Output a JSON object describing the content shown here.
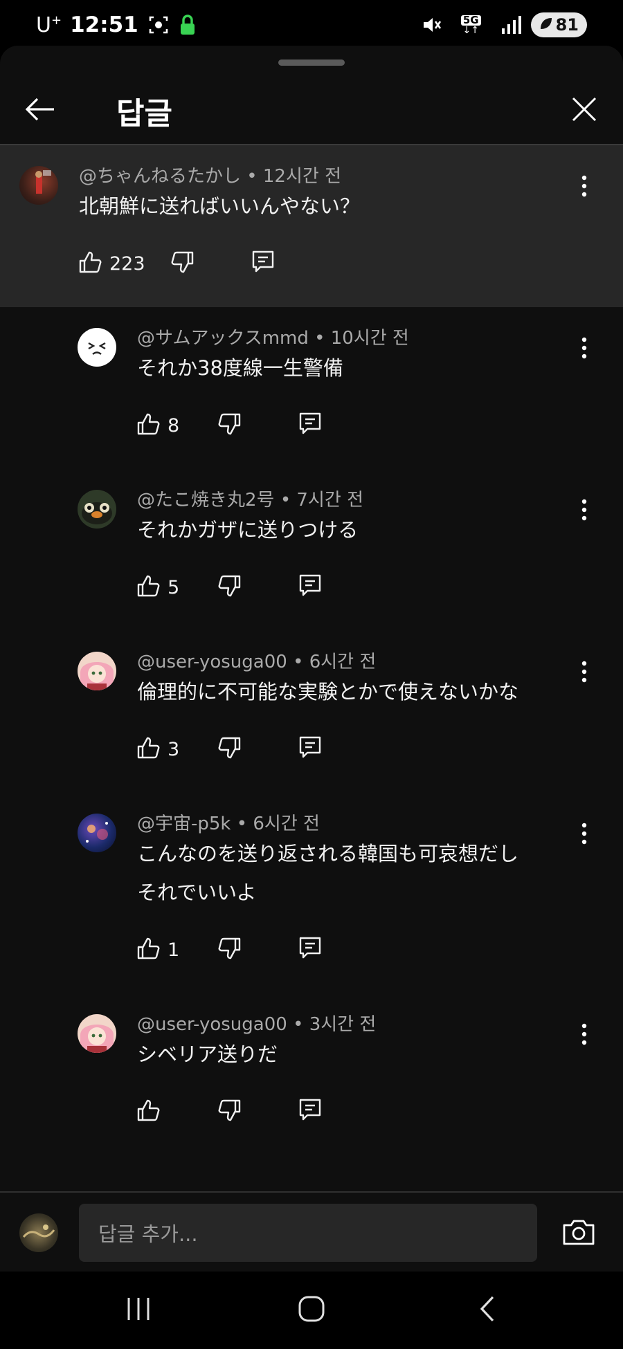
{
  "status_bar": {
    "carrier": "U",
    "carrier_sup": "+",
    "time": "12:51",
    "network": "5G",
    "battery": "81"
  },
  "header": {
    "title": "답글"
  },
  "parent": {
    "author": "@ちゃんねるたかし",
    "time": "12시간 전",
    "text": "北朝鮮に送ればいいんやない？",
    "likes": "223"
  },
  "replies": [
    {
      "author": "@サムアックスmmd",
      "time": "10시간 전",
      "lines": [
        "それか38度線一生警備"
      ],
      "likes": "8"
    },
    {
      "author": "@たこ焼き丸2号",
      "time": "7시간 전",
      "lines": [
        "それかガザに送りつける"
      ],
      "likes": "5"
    },
    {
      "author": "@user-yosuga00",
      "time": "6시간 전",
      "lines": [
        "倫理的に不可能な実験とかで使えないかな"
      ],
      "likes": "3"
    },
    {
      "author": "@宇宙-p5k",
      "time": "6시간 전",
      "lines": [
        "こんなのを送り返される韓国も可哀想だし",
        "それでいいよ"
      ],
      "likes": "1"
    },
    {
      "author": "@user-yosuga00",
      "time": "3시간 전",
      "lines": [
        "シベリア送りだ"
      ],
      "likes": ""
    }
  ],
  "meta_separator": "•",
  "input": {
    "placeholder": "답글 추가..."
  },
  "colors": {
    "sheet_bg": "#0f0f0f",
    "highlight_bg": "#272727",
    "secondary_text": "#aaaaaa",
    "primary_text": "#f1f1f1"
  }
}
